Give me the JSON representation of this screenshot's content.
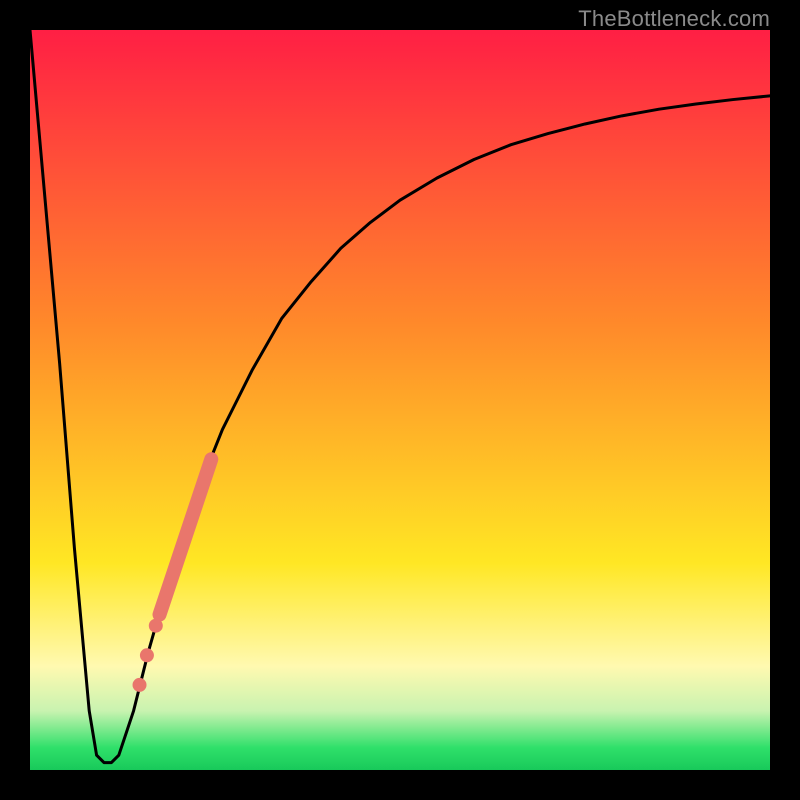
{
  "watermark": "TheBottleneck.com",
  "colors": {
    "top": "#ff1f44",
    "mid_orange": "#ff8a2a",
    "mid_yellow": "#ffe724",
    "pale_yellow": "#fff9b0",
    "pale_green": "#c9f3b0",
    "green": "#2fe06a",
    "bottom_green": "#18c95a",
    "curve": "#000000",
    "marker": "#e9766c",
    "frame": "#000000"
  },
  "chart_data": {
    "type": "line",
    "title": "",
    "xlabel": "",
    "ylabel": "",
    "x_range": [
      0,
      100
    ],
    "y_range": [
      0,
      100
    ],
    "series": [
      {
        "name": "bottleneck-curve",
        "x": [
          0,
          4,
          6,
          8,
          9,
          10,
          11,
          12,
          14,
          16,
          18,
          20,
          22,
          24,
          26,
          28,
          30,
          34,
          38,
          42,
          46,
          50,
          55,
          60,
          65,
          70,
          75,
          80,
          85,
          90,
          95,
          100
        ],
        "y": [
          100,
          55,
          30,
          8,
          2,
          1,
          1,
          2,
          8,
          16,
          23,
          30,
          36,
          41,
          46,
          50,
          54,
          61,
          66,
          70.5,
          74,
          77,
          80,
          82.5,
          84.5,
          86,
          87.3,
          88.4,
          89.3,
          90,
          90.6,
          91.1
        ]
      }
    ],
    "marker_segment": {
      "name": "highlighted-range",
      "x_start": 17.5,
      "y_start": 21,
      "x_end": 24.5,
      "y_end": 42
    },
    "marker_dots": [
      {
        "x": 17.0,
        "y": 19.5
      },
      {
        "x": 15.8,
        "y": 15.5
      },
      {
        "x": 14.8,
        "y": 11.5
      }
    ],
    "gradient_stops": [
      {
        "offset": 0.0,
        "color_key": "top"
      },
      {
        "offset": 0.4,
        "color_key": "mid_orange"
      },
      {
        "offset": 0.72,
        "color_key": "mid_yellow"
      },
      {
        "offset": 0.86,
        "color_key": "pale_yellow"
      },
      {
        "offset": 0.92,
        "color_key": "pale_green"
      },
      {
        "offset": 0.97,
        "color_key": "green"
      },
      {
        "offset": 1.0,
        "color_key": "bottom_green"
      }
    ]
  }
}
